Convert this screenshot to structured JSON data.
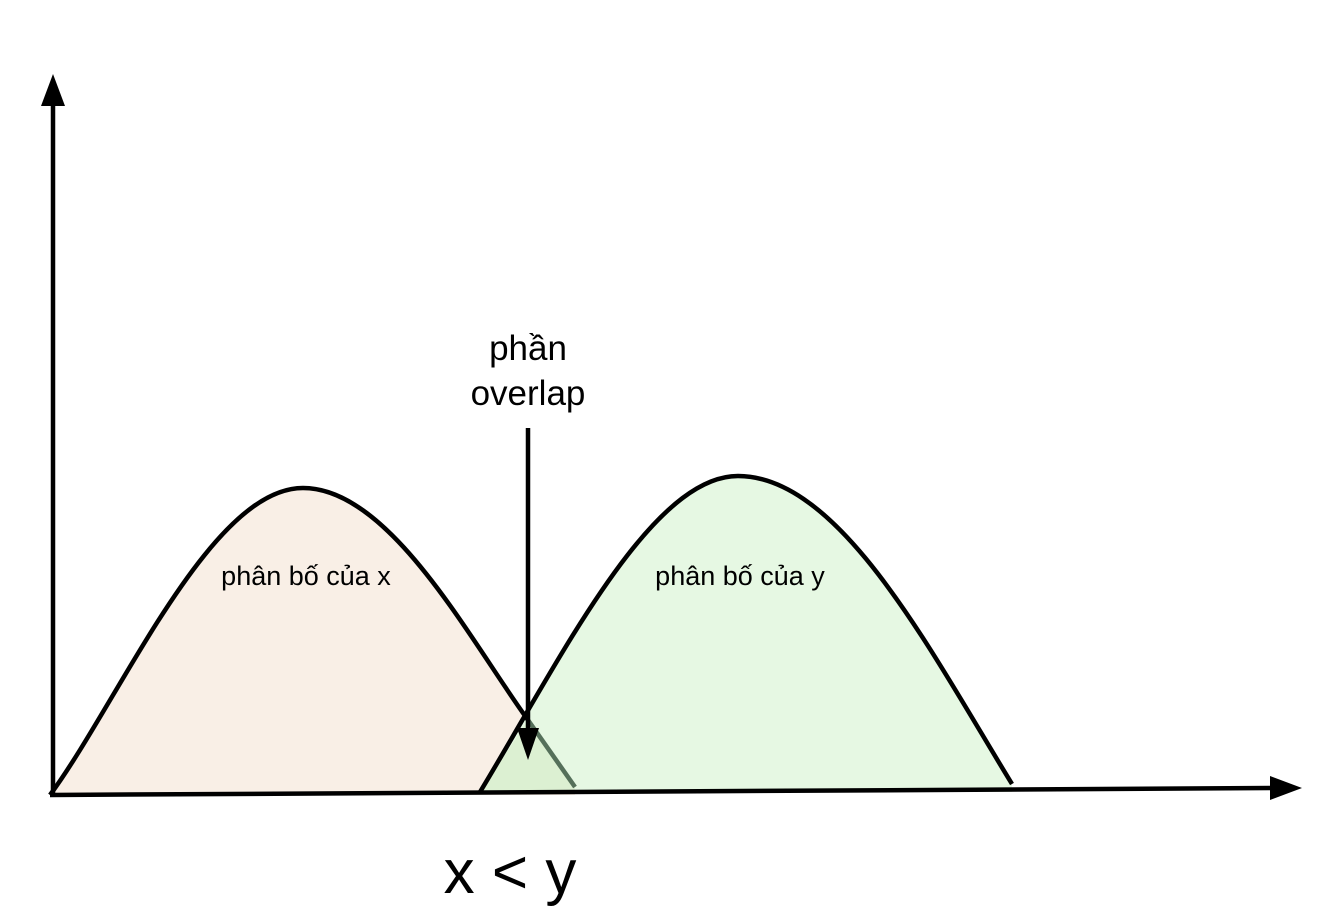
{
  "labels": {
    "dist_x": "phân bố của x",
    "dist_y": "phân bố của y",
    "overlap_line1": "phần",
    "overlap_line2": "overlap",
    "caption": "x < y"
  },
  "colors": {
    "dist_x_fill": "#f9efe6",
    "dist_y_fill": "#e6f8e3",
    "overlap_fill": "#dcf0d2",
    "stroke": "#000000",
    "faded_tail": "#55705a"
  }
}
